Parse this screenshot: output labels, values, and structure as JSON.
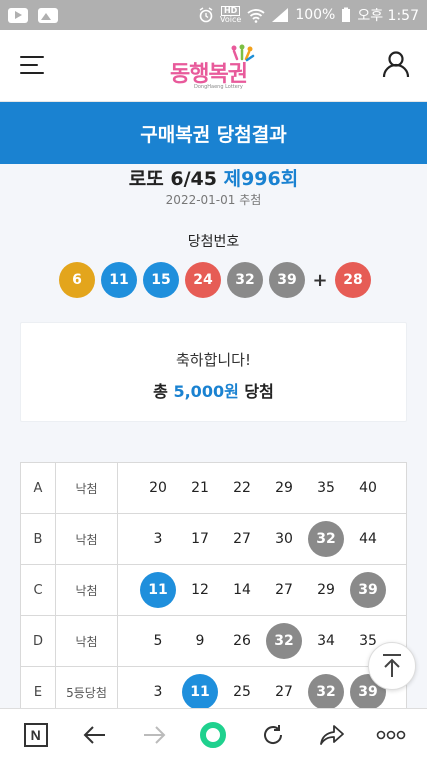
{
  "status_bar": {
    "hd_label": "HD",
    "voice_label": "Voice",
    "battery": "100%",
    "time": "오후 1:57"
  },
  "header": {
    "logo_text": "동행복권",
    "logo_sub": "DongHaeng Lottery"
  },
  "page": {
    "title": "구매복권 당첨결과"
  },
  "draw": {
    "game": "로또 6/45",
    "round": "제996회",
    "date": "2022-01-01 추첨",
    "winning_label": "당첨번호",
    "winning_numbers": [
      {
        "n": "6",
        "color": "#e3a51c"
      },
      {
        "n": "11",
        "color": "#1f8fdc"
      },
      {
        "n": "15",
        "color": "#1f8fdc"
      },
      {
        "n": "24",
        "color": "#e65c55"
      },
      {
        "n": "32",
        "color": "#8a8a8a"
      },
      {
        "n": "39",
        "color": "#8a8a8a"
      }
    ],
    "plus": "+",
    "bonus_number": {
      "n": "28",
      "color": "#e65c55"
    }
  },
  "result": {
    "congrats": "축하합니다!",
    "prize_prefix": "총",
    "prize_amount": "5,000원",
    "prize_suffix": "당첨"
  },
  "ticket": {
    "rows": [
      {
        "game": "A",
        "rank": "낙첨",
        "numbers": [
          "20",
          "21",
          "22",
          "29",
          "35",
          "40"
        ],
        "hits": [
          null,
          null,
          null,
          null,
          null,
          null
        ]
      },
      {
        "game": "B",
        "rank": "낙첨",
        "numbers": [
          "3",
          "17",
          "27",
          "30",
          "32",
          "44"
        ],
        "hits": [
          null,
          null,
          null,
          null,
          "#8a8a8a",
          null
        ]
      },
      {
        "game": "C",
        "rank": "낙첨",
        "numbers": [
          "11",
          "12",
          "14",
          "27",
          "29",
          "39"
        ],
        "hits": [
          "#1f8fdc",
          null,
          null,
          null,
          null,
          "#8a8a8a"
        ]
      },
      {
        "game": "D",
        "rank": "낙첨",
        "numbers": [
          "5",
          "9",
          "26",
          "32",
          "34",
          "35"
        ],
        "hits": [
          null,
          null,
          null,
          "#8a8a8a",
          null,
          null
        ]
      },
      {
        "game": "E",
        "rank": "5등당첨",
        "numbers": [
          "3",
          "11",
          "25",
          "27",
          "32",
          "39"
        ],
        "hits": [
          null,
          "#1f8fdc",
          null,
          null,
          "#8a8a8a",
          "#8a8a8a"
        ]
      }
    ]
  },
  "bottom_bar": {
    "n_label": "N",
    "more_label": "ooo"
  },
  "colors": {
    "primary": "#1a82d1",
    "ball_yellow": "#e3a51c",
    "ball_blue": "#1f8fdc",
    "ball_red": "#e65c55",
    "ball_gray": "#8a8a8a",
    "accent_green": "#1fd18e"
  },
  "icons": [
    "youtube-icon",
    "gallery-icon",
    "alarm-icon",
    "wifi-icon",
    "signal-icon",
    "menu-icon",
    "user-icon",
    "scroll-top-icon",
    "back-icon",
    "forward-icon",
    "refresh-icon",
    "share-icon",
    "more-icon"
  ]
}
